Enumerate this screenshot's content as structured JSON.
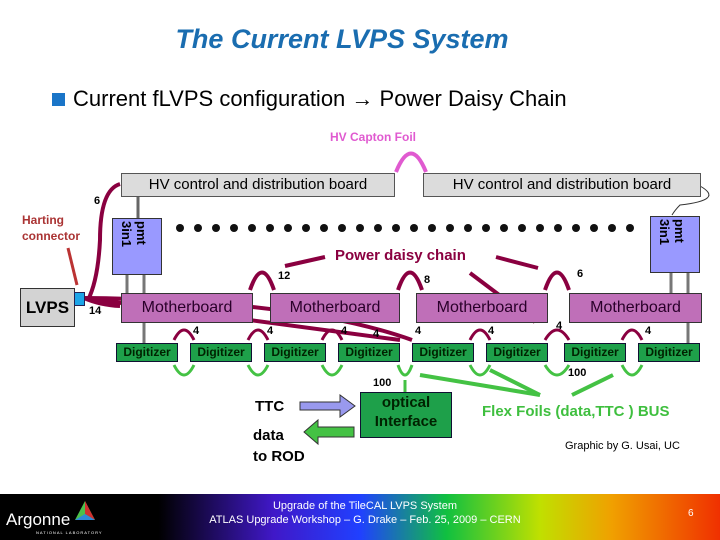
{
  "title": "The Current LVPS System",
  "bullet": "Current fLVPS configuration → Power Daisy Chain",
  "hv_foil_label": "HV Capton Foil",
  "hv_boards": [
    "HV control and distribution board",
    "HV control and distribution board"
  ],
  "pmt_label": "pmt 3in1",
  "harting_label": [
    "Harting",
    "connector"
  ],
  "lvps_label": "LVPS",
  "daisy_label": "Power daisy chain",
  "motherboards": [
    "Motherboard",
    "Motherboard",
    "Motherboard",
    "Motherboard"
  ],
  "digitizers": [
    "Digitizer",
    "Digitizer",
    "Digitizer",
    "Digitizer",
    "Digitizer",
    "Digitizer",
    "Digitizer",
    "Digitizer"
  ],
  "wire_counts": {
    "lvps_to_mb": "14",
    "hv": "6",
    "mb1_mb2": "12",
    "mb2_mb3": "8",
    "mb3_mb4": "6",
    "dig": "4",
    "flex_left": "100",
    "flex_right": "100"
  },
  "optical_label": [
    "optical",
    "Interface"
  ],
  "ttc_label": "TTC",
  "data_label": [
    "data",
    "to ROD"
  ],
  "flex_label": "Flex Foils (data,TTC ) BUS",
  "credit": "Graphic by G. Usai, UC",
  "footer": {
    "line1": "Upgrade of the TileCAL LVPS System",
    "line2": "ATLAS Upgrade Workshop – G. Drake – Feb. 25, 2009  – CERN",
    "page": "6",
    "logo": "Argonne",
    "logo_sub": "NATIONAL LABORATORY"
  },
  "colors": {
    "title": "#1a6db0",
    "motherboard": "#bf6fb8",
    "digitizer": "#1ea04a",
    "pmt": "#9999ff",
    "daisy": "#8a0040",
    "flex": "#3fbf3f"
  }
}
